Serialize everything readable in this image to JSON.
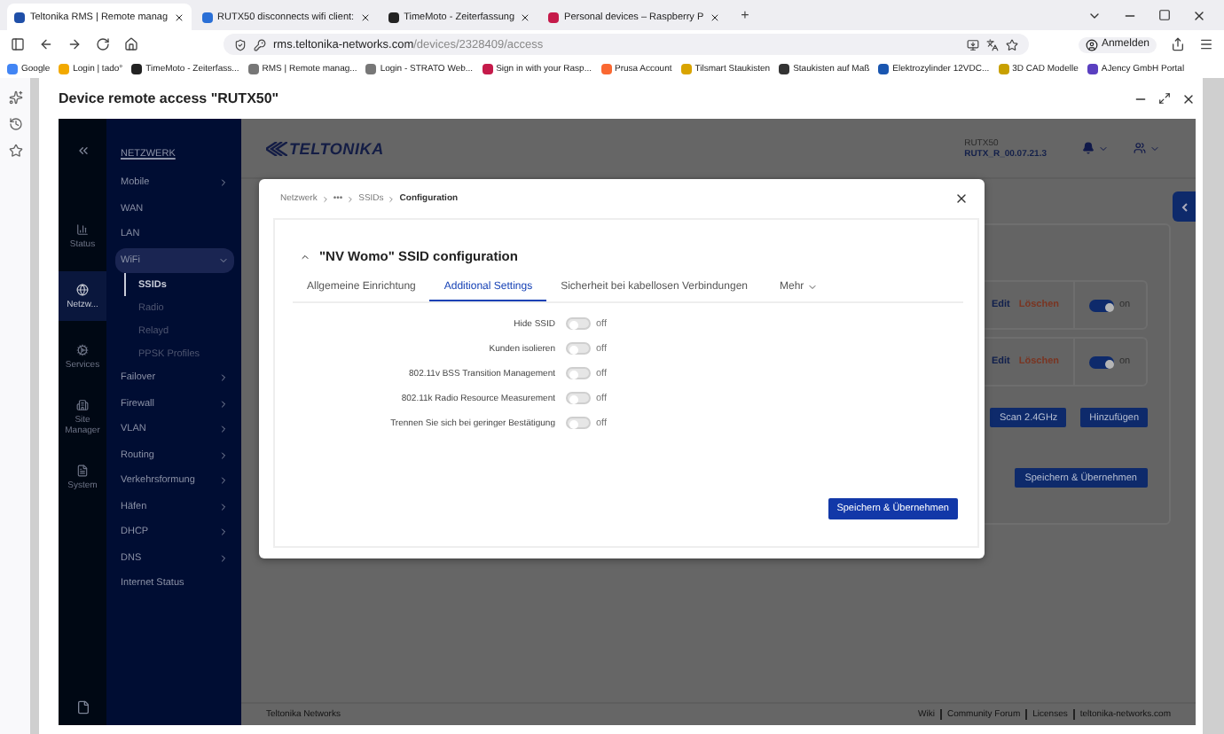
{
  "browser": {
    "tabs": [
      {
        "label": "Teltonika RMS | Remote manag",
        "selected": true,
        "color": "#1f4fa8"
      },
      {
        "label": "RUTX50 disconnects wifi client:",
        "selected": false,
        "color": "#2a6fd6"
      },
      {
        "label": "TimeMoto - Zeiterfassung",
        "selected": false,
        "color": "#222222"
      },
      {
        "label": "Personal devices – Raspberry P",
        "selected": false,
        "color": "#c51a4a"
      }
    ],
    "new_tab": "+",
    "url_host": "rms.teltonika-networks.com",
    "url_path": "/devices/2328409/access",
    "profile": "Anmelden",
    "bookmarks": [
      {
        "label": "Google",
        "color": "#4285f4"
      },
      {
        "label": "Login | tado°",
        "color": "#f2a900"
      },
      {
        "label": "TimeMoto - Zeiterfass...",
        "color": "#222222"
      },
      {
        "label": "RMS | Remote manag...",
        "color": "#777777"
      },
      {
        "label": "Login - STRATO Web...",
        "color": "#777777"
      },
      {
        "label": "Sign in with your Rasp...",
        "color": "#c51a4a"
      },
      {
        "label": "Prusa Account",
        "color": "#fa6831"
      },
      {
        "label": "Tilsmart Staukisten",
        "color": "#d9a400"
      },
      {
        "label": "Staukisten auf Maß",
        "color": "#333333"
      },
      {
        "label": "Elektrozylinder 12VDC...",
        "color": "#1a56b0"
      },
      {
        "label": "3D CAD Modelle",
        "color": "#c8a000"
      },
      {
        "label": "AJency GmbH Portal",
        "color": "#5a3fc0"
      }
    ]
  },
  "panel": {
    "title": "Device remote access \"RUTX50\""
  },
  "router": {
    "rail": [
      {
        "label": "Status",
        "selected": false
      },
      {
        "label": "Netzw...",
        "selected": true
      },
      {
        "label": "Services",
        "selected": false
      },
      {
        "label": "Site Manager",
        "selected": false
      },
      {
        "label": "System",
        "selected": false
      }
    ],
    "nav_heading": "NETZWERK",
    "nav": [
      {
        "label": "Mobile",
        "kind": "submenu",
        "expanded": false
      },
      {
        "label": "WAN",
        "kind": "link",
        "expanded": false
      },
      {
        "label": "LAN",
        "kind": "link",
        "expanded": false
      },
      {
        "label": "WiFi",
        "kind": "submenu",
        "expanded": true,
        "children": [
          {
            "label": "SSIDs",
            "selected": true
          },
          {
            "label": "Radio",
            "selected": false
          },
          {
            "label": "Relayd",
            "selected": false
          },
          {
            "label": "PPSK Profiles",
            "selected": false
          }
        ]
      },
      {
        "label": "Failover",
        "kind": "submenu",
        "expanded": false
      },
      {
        "label": "Firewall",
        "kind": "submenu",
        "expanded": false
      },
      {
        "label": "VLAN",
        "kind": "submenu",
        "expanded": false
      },
      {
        "label": "Routing",
        "kind": "submenu",
        "expanded": false
      },
      {
        "label": "Verkehrsformung",
        "kind": "submenu",
        "expanded": false
      },
      {
        "label": "Häfen",
        "kind": "submenu",
        "expanded": false
      },
      {
        "label": "DHCP",
        "kind": "submenu",
        "expanded": false
      },
      {
        "label": "DNS",
        "kind": "submenu",
        "expanded": false
      },
      {
        "label": "Internet Status",
        "kind": "link",
        "expanded": false
      }
    ],
    "logo": "TELTONIKA",
    "device": {
      "model": "RUTX50",
      "firmware": "RUTX_R_00.07.21.3"
    },
    "ssid_rows": [
      {
        "edit": "Edit",
        "delete": "Löschen",
        "on": true,
        "state_label": "on"
      },
      {
        "edit": "Edit",
        "delete": "Löschen",
        "on": true,
        "state_label": "on"
      }
    ],
    "buttons": [
      "Scan 2.4GHz",
      "Hinzufügen"
    ],
    "save": "Speichern & Übernehmen",
    "footer_left": "Teltonika Networks",
    "footer_links": [
      "Wiki",
      "Community Forum",
      "Licenses",
      "teltonika-networks.com"
    ]
  },
  "modal": {
    "breadcrumb": [
      "Netzwerk",
      "•••",
      "SSIDs",
      "Configuration"
    ],
    "title": "\"NV Womo\" SSID configuration",
    "tabs": [
      {
        "label": "Allgemeine Einrichtung",
        "selected": false
      },
      {
        "label": "Additional Settings",
        "selected": true
      },
      {
        "label": "Sicherheit bei kabellosen Verbindungen",
        "selected": false
      }
    ],
    "more": "Mehr",
    "settings": [
      {
        "label": "Hide SSID",
        "on": false,
        "state_label": "off"
      },
      {
        "label": "Kunden isolieren",
        "on": false,
        "state_label": "off"
      },
      {
        "label": "802.11v BSS Transition Management",
        "on": false,
        "state_label": "off"
      },
      {
        "label": "802.11k Radio Resource Measurement",
        "on": false,
        "state_label": "off"
      },
      {
        "label": "Trennen Sie sich bei geringer Bestätigung",
        "on": false,
        "state_label": "off"
      }
    ],
    "save": "Speichern & Übernehmen"
  }
}
